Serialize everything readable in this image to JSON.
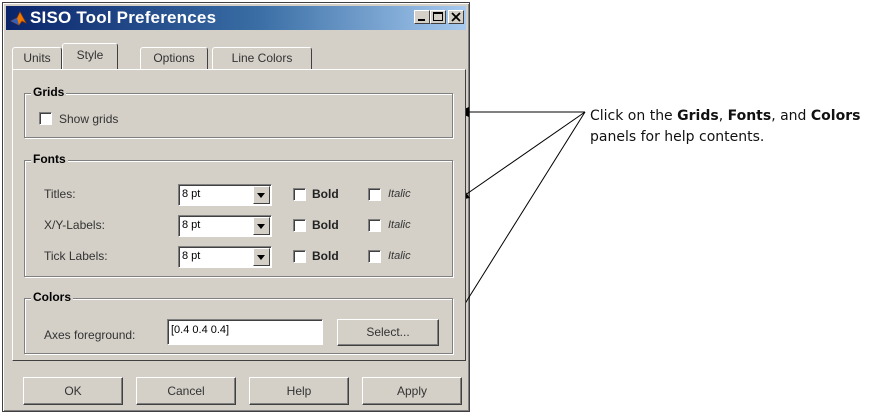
{
  "window": {
    "title": "SISO Tool Preferences"
  },
  "tabs": [
    {
      "label": "Units"
    },
    {
      "label": "Style"
    },
    {
      "label": "Options"
    },
    {
      "label": "Line Colors"
    }
  ],
  "grids": {
    "title": "Grids",
    "show_grids_label": "Show grids",
    "show_grids_checked": false
  },
  "fonts": {
    "title": "Fonts",
    "bold_label": "Bold",
    "italic_label": "Italic",
    "rows": [
      {
        "label": "Titles:",
        "size": "8 pt"
      },
      {
        "label": "X/Y-Labels:",
        "size": "8 pt"
      },
      {
        "label": "Tick Labels:",
        "size": "8 pt"
      }
    ]
  },
  "colors": {
    "title": "Colors",
    "axes_label": "Axes foreground:",
    "axes_value": "[0.4 0.4 0.4]",
    "select_label": "Select..."
  },
  "buttons": {
    "ok": "OK",
    "cancel": "Cancel",
    "help": "Help",
    "apply": "Apply"
  },
  "annotation": {
    "line1_prefix": "Click on the ",
    "grids": "Grids",
    "sep1": ", ",
    "fonts": "Fonts",
    "sep2": ", and ",
    "colors": "Colors",
    "line2": "panels for help contents."
  }
}
